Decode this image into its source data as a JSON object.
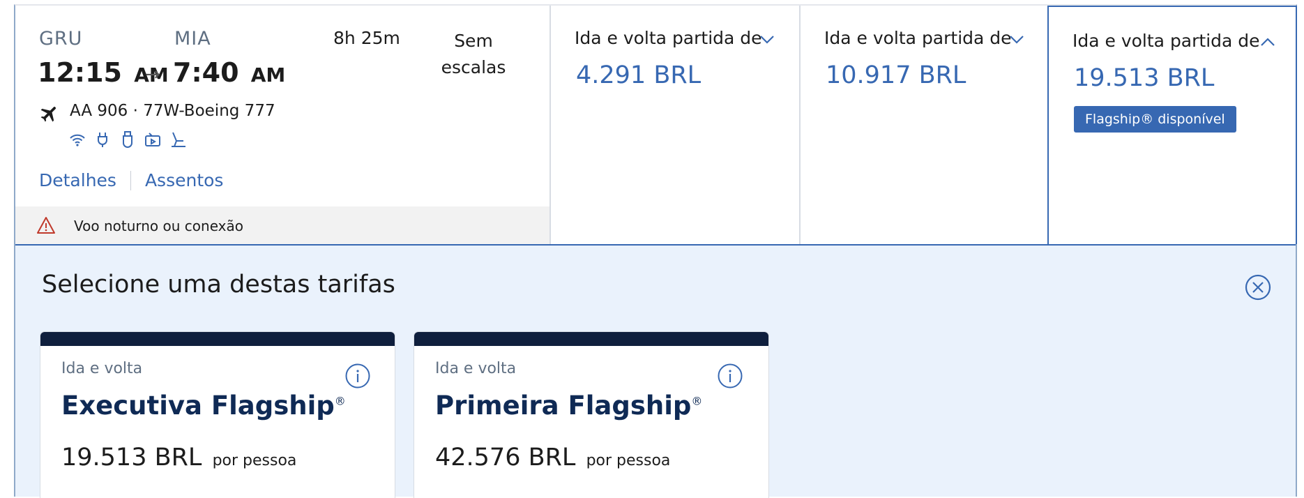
{
  "flight": {
    "origin_code": "GRU",
    "dest_code": "MIA",
    "depart_time": "12:15",
    "depart_ampm": "AM",
    "arrive_time": "7:40",
    "arrive_ampm": "AM",
    "duration": "8h 25m",
    "stops": "Sem escalas",
    "flight_info": "AA 906 · 77W-Boeing 777",
    "amenities": [
      "wifi-icon",
      "power-outlet-icon",
      "usb-icon",
      "entertainment-icon",
      "seat-icon"
    ],
    "details_link": "Detalhes",
    "seats_link": "Assentos",
    "notice": "Voo noturno ou conexão"
  },
  "fares": [
    {
      "label": "Ida e volta partida de",
      "price": "4.291 BRL",
      "expanded": false
    },
    {
      "label": "Ida e volta partida de",
      "price": "10.917 BRL",
      "expanded": false
    },
    {
      "label": "Ida e volta partida de",
      "price": "19.513 BRL",
      "expanded": true,
      "badge": "Flagship® disponível"
    }
  ],
  "panel": {
    "title": "Selecione uma destas tarifas",
    "options": [
      {
        "trip": "Ida e volta",
        "name": "Executiva Flagship",
        "reg": "®",
        "price": "19.513 BRL",
        "per": "por pessoa"
      },
      {
        "trip": "Ida e volta",
        "name": "Primeira Flagship",
        "reg": "®",
        "price": "42.576 BRL",
        "per": "por pessoa"
      }
    ]
  },
  "colors": {
    "accent": "#3768b2",
    "navy": "#0f1f3d",
    "panel_bg": "#eaf2fc",
    "warning": "#c0392b"
  }
}
